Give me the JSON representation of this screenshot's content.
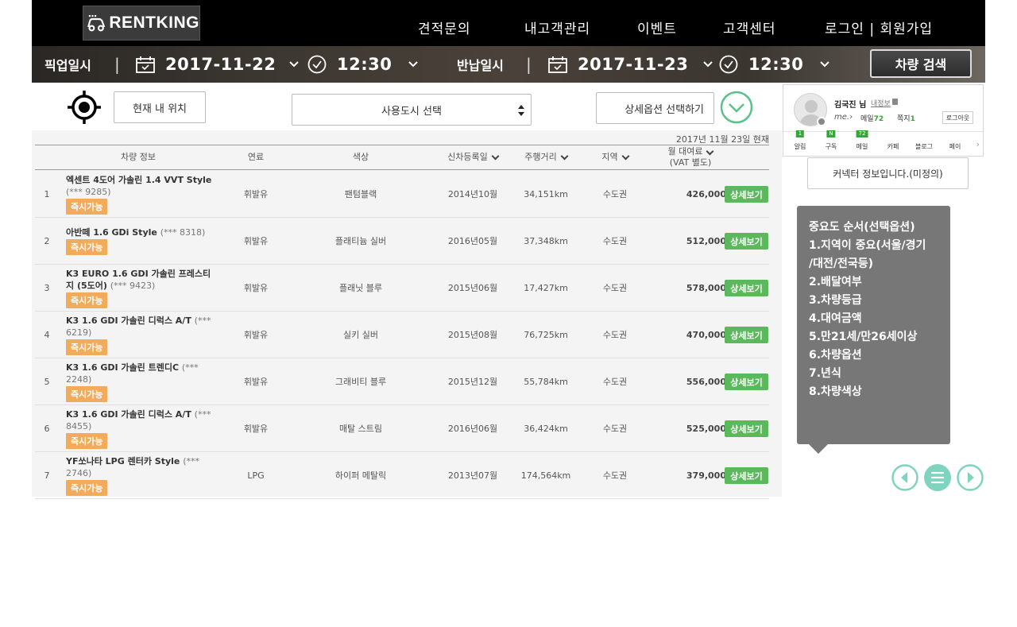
{
  "header": {
    "logo_text": "RENTKING",
    "nav": [
      "견적문의",
      "내고객관리",
      "이벤트",
      "고객센터",
      "로그인 | 회원가입"
    ]
  },
  "search_bar": {
    "pickup_label": "픽업일시",
    "pickup_date": "2017-11-22",
    "pickup_time": "12:30",
    "return_label": "반납일시",
    "return_date": "2017-11-23",
    "return_time": "12:30",
    "separator": "|",
    "search_button": "차량 검색"
  },
  "filters": {
    "my_location": "현재 내 위치",
    "city_select": "사용도시 선택",
    "detail_options": "상세옵션 선택하기"
  },
  "table": {
    "as_of": "2017년 11월 23일 현재",
    "headers": {
      "info": "차량 정보",
      "fuel": "연료",
      "color": "색상",
      "registered": "신차등록일",
      "mileage": "주행거리",
      "region": "지역",
      "price_line1": "월 대여료",
      "price_line2": "(VAT 별도)"
    },
    "badge": "즉시가능",
    "detail_button": "상세보기",
    "rows": [
      {
        "num": "1",
        "name": "엑센트 4도어 가솔린 1.4 VVT Style",
        "plate": "(*** 9285)",
        "fuel": "휘발유",
        "color": "팬텀블랙",
        "registered": "2014년10월",
        "mileage": "34,151km",
        "region": "수도권",
        "price": "426,000"
      },
      {
        "num": "2",
        "name": "아반떼 1.6 GDi Style",
        "plate": "(*** 8318)",
        "fuel": "휘발유",
        "color": "플래티늄 실버",
        "registered": "2016년05월",
        "mileage": "37,348km",
        "region": "수도권",
        "price": "512,000"
      },
      {
        "num": "3",
        "name": "K3 EURO 1.6 GDI 가솔린 프레스티지 (5도어)",
        "plate": "(*** 9423)",
        "fuel": "휘발유",
        "color": "플래닛 블루",
        "registered": "2015년06월",
        "mileage": "17,427km",
        "region": "수도권",
        "price": "578,000"
      },
      {
        "num": "4",
        "name": "K3 1.6 GDI 가솔린 디럭스 A/T",
        "plate": "(*** 6219)",
        "fuel": "휘발유",
        "color": "실키 실버",
        "registered": "2015년08월",
        "mileage": "76,725km",
        "region": "수도권",
        "price": "470,000"
      },
      {
        "num": "5",
        "name": "K3 1.6 GDI 가솔린 트렌디C",
        "plate": "(*** 2248)",
        "fuel": "휘발유",
        "color": "그래비티 블루",
        "registered": "2015년12월",
        "mileage": "55,784km",
        "region": "수도권",
        "price": "556,000"
      },
      {
        "num": "6",
        "name": "K3 1.6 GDI 가솔린 디럭스 A/T",
        "plate": "(*** 8455)",
        "fuel": "휘발유",
        "color": "매탈 스트림",
        "registered": "2016년06월",
        "mileage": "36,424km",
        "region": "수도권",
        "price": "525,000"
      },
      {
        "num": "7",
        "name": "YF쏘나타 LPG 렌터카 Style",
        "plate": "(*** 2746)",
        "fuel": "LPG",
        "color": "하이퍼 메탈릭",
        "registered": "2013년07월",
        "mileage": "174,564km",
        "region": "수도권",
        "price": "379,000"
      }
    ]
  },
  "naver_widget": {
    "user_name": "김국진 님",
    "my_info": "내정보",
    "me": "me",
    "mail_label": "메일",
    "mail_count": "72",
    "note_label": "쪽지",
    "note_count": "1",
    "logout": "로그아웃",
    "tabs": [
      {
        "label": "알림",
        "count": "1"
      },
      {
        "label": "구독",
        "count": "N"
      },
      {
        "label": "메일",
        "count": "72"
      },
      {
        "label": "카페",
        "count": ""
      },
      {
        "label": "블로그",
        "count": ""
      },
      {
        "label": "페이",
        "count": ""
      }
    ],
    "more": "›"
  },
  "connector_info": "커넥터 정보입니다.(미정의)",
  "tooltip": {
    "lines": [
      "중요도 순서(선택옵션)",
      "1.지역이 중요(서울/경기",
      "/대전/전국등)",
      "2.배달여부",
      "3.차량등급",
      "4.대여금액",
      "5.만21세/만26세이상",
      "6.차량옵션",
      "7.년식",
      "8.차량색상"
    ]
  },
  "colors": {
    "accent_green": "#5cb85c",
    "badge_orange": "#f2ab5a",
    "mint": "#7fd4bf",
    "tooltip_gray": "#777777"
  }
}
